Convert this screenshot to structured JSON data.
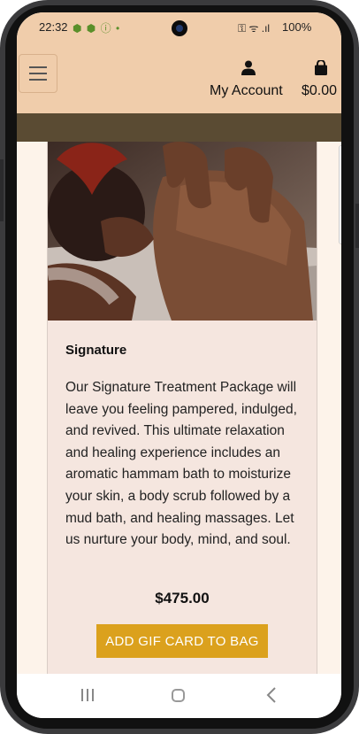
{
  "status_bar": {
    "time": "22:32",
    "left_icons": "⬢ ⬢ ⓘ •",
    "right_icons": "⚿ ᯤ .ıl",
    "battery": "100%"
  },
  "header": {
    "account_label": "My Account",
    "bag_total": "$0.00"
  },
  "product": {
    "title": "Signature",
    "description": "Our Signature Treatment Package will leave you feeling pampered, indulged, and revived. This ultimate relaxation and healing experience includes an aromatic hammam bath to moisturize your skin, a body scrub followed by a mud bath, and healing massages. Let us nurture your body, mind, and soul.",
    "price": "$475.00",
    "button_label": "ADD GIF CARD TO BAG"
  },
  "colors": {
    "header_bg": "#f0cdab",
    "banner_bg": "#5a4b33",
    "card_bg": "#f5e6df",
    "button_bg": "#dba11d"
  }
}
